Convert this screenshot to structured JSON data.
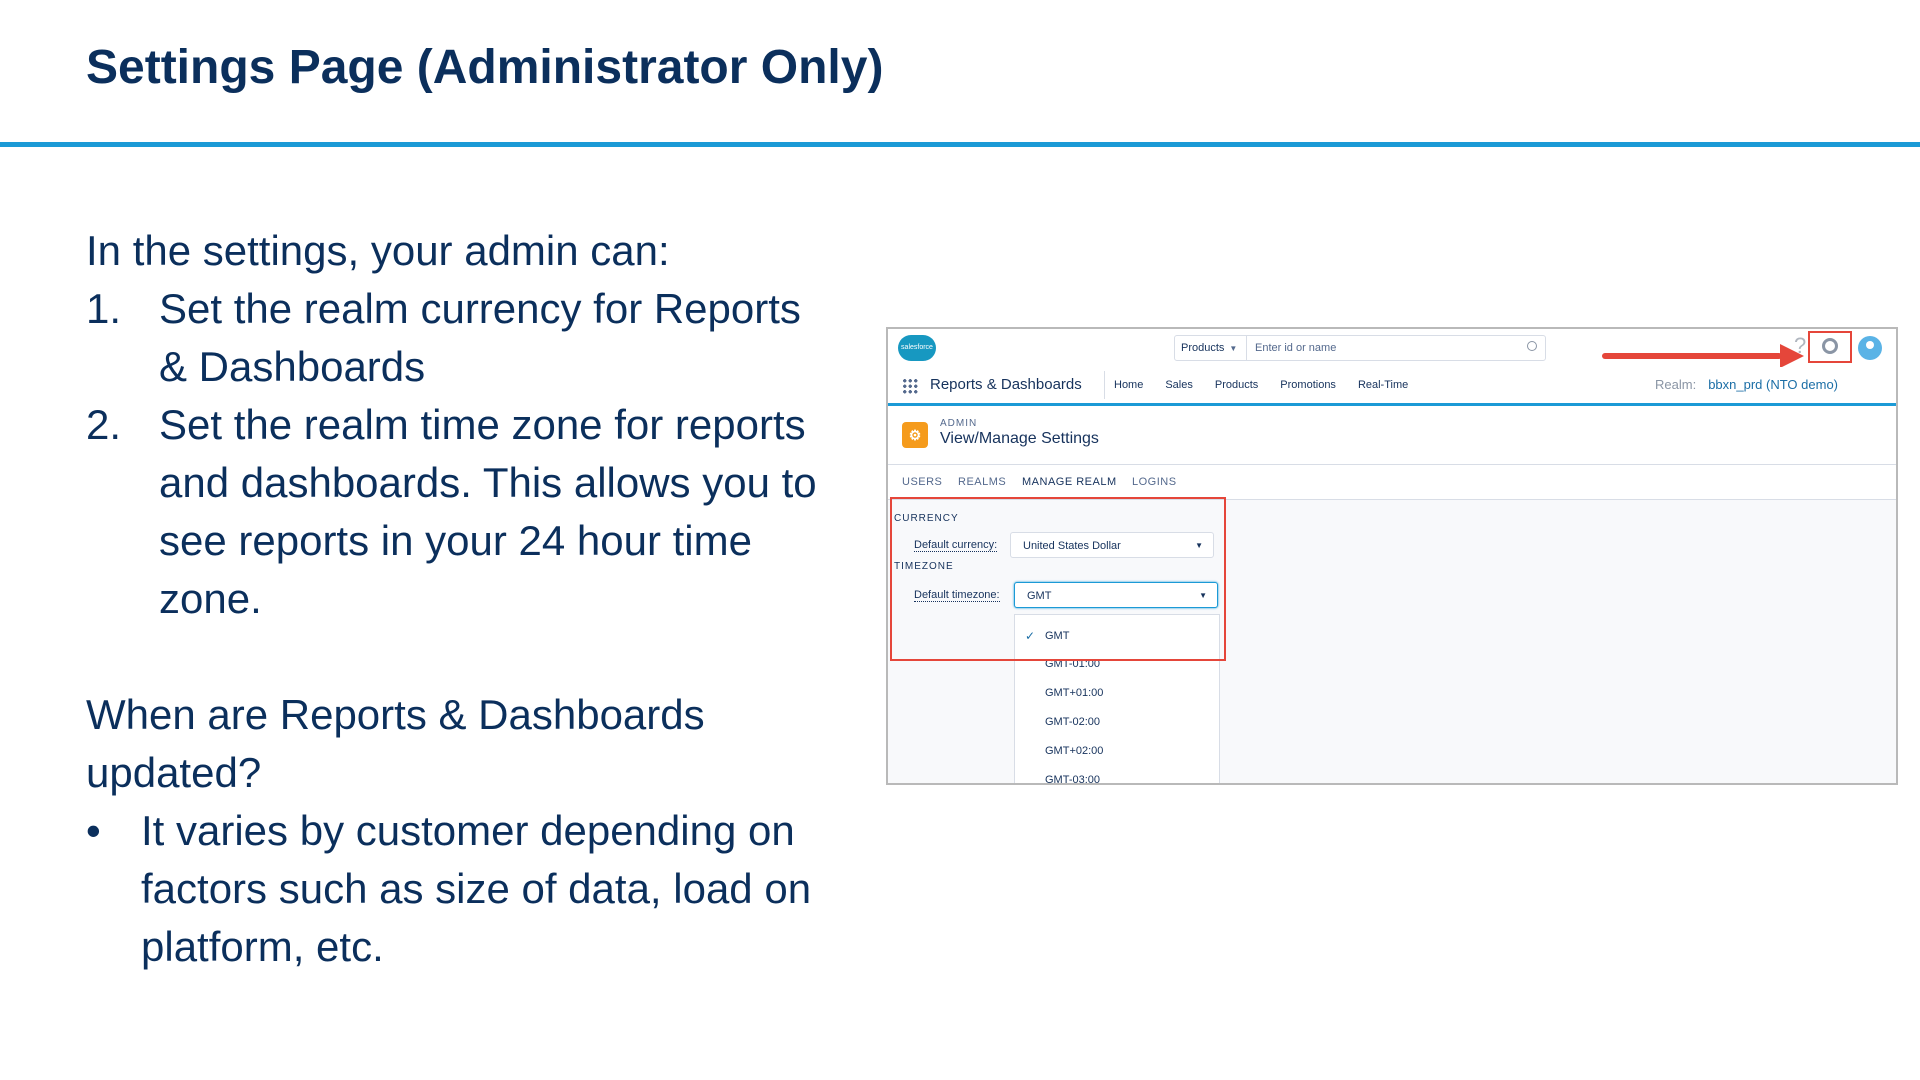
{
  "slide": {
    "title": "Settings Page (Administrator Only)",
    "intro": "In the settings, your admin can:",
    "steps": [
      {
        "num": "1.",
        "lines": [
          "Set the realm currency for Reports",
          "& Dashboards"
        ]
      },
      {
        "num": "2.",
        "lines": [
          "Set the realm time zone for reports",
          "and dashboards. This allows you to",
          "see reports in your 24 hour time",
          "zone."
        ]
      }
    ],
    "question_lines": [
      "When are Reports & Dashboards",
      "updated?"
    ],
    "bullet_char": "•",
    "bullet_lines": [
      "It varies by customer depending on",
      "factors such as size of data, load on",
      "platform, etc."
    ]
  },
  "screenshot": {
    "logo_text": "salesforce",
    "search_scope": "Products",
    "search_placeholder": "Enter id or name",
    "help_icon": "?",
    "app_name": "Reports & Dashboards",
    "nav_items": [
      "Home",
      "Sales",
      "Products",
      "Promotions",
      "Real-Time"
    ],
    "realm_label": "Realm:",
    "realm_value": "bbxn_prd (NTO demo)",
    "header_kicker": "ADMIN",
    "header_title": "View/Manage Settings",
    "tabs": [
      "USERS",
      "REALMS",
      "MANAGE REALM",
      "LOGINS"
    ],
    "active_tab": "MANAGE REALM",
    "currency_section": "CURRENCY",
    "currency_label": "Default currency:",
    "currency_value": "United States Dollar",
    "timezone_section": "TIMEZONE",
    "timezone_label": "Default timezone:",
    "timezone_value": "GMT",
    "timezone_options": [
      "GMT",
      "GMT-01:00",
      "GMT+01:00",
      "GMT-02:00",
      "GMT+02:00",
      "GMT-03:00"
    ],
    "selected_option": "GMT",
    "check_glyph": "✓",
    "colors": {
      "accent_blue": "#1b9ad6",
      "highlight_red": "#e5463a",
      "title_navy": "#0b2f5c",
      "app_icon_orange": "#f59b1c"
    }
  }
}
